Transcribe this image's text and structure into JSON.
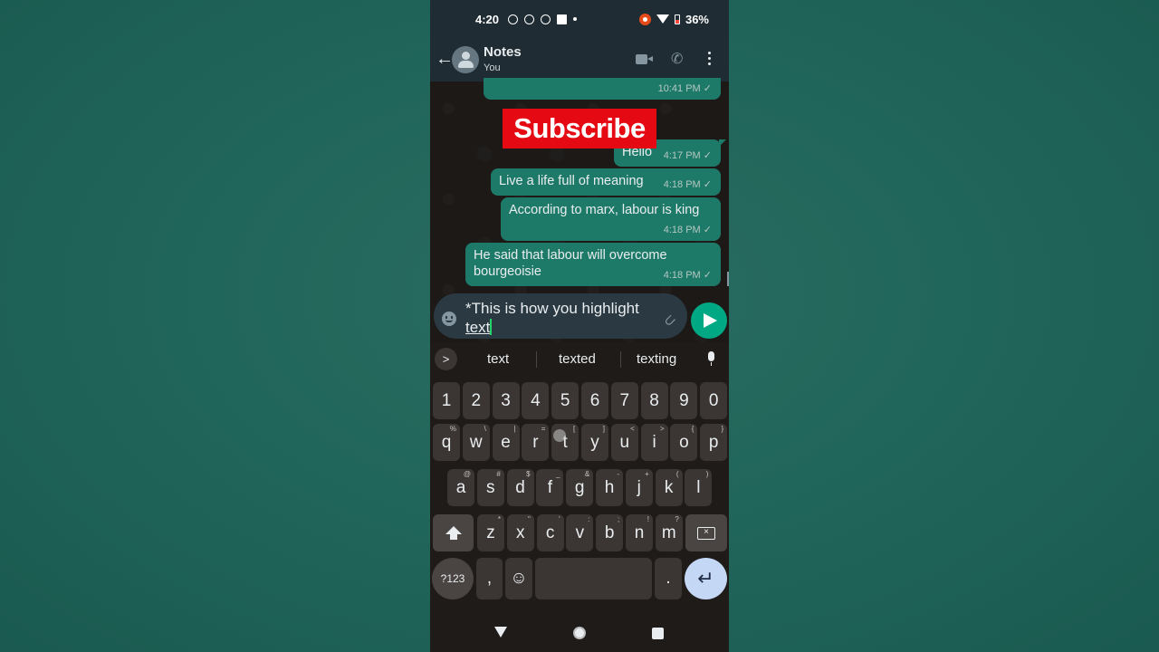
{
  "status_bar": {
    "time": "4:20",
    "battery": "36%"
  },
  "header": {
    "title": "Notes",
    "subtitle": "You"
  },
  "overlay": {
    "subscribe": "Subscribe"
  },
  "messages": [
    {
      "text": "",
      "time": "10:41 PM ✓"
    },
    {
      "text": "Hello",
      "time": "4:17 PM ✓"
    },
    {
      "text": "Live a life full of meaning",
      "time": "4:18 PM ✓"
    },
    {
      "text": "According to marx, labour is king",
      "time": "4:18 PM ✓"
    },
    {
      "text": "He said that labour will overcome bourgeoisie",
      "time": "4:18 PM ✓"
    }
  ],
  "composer": {
    "line1": "*This is how you highlight",
    "line2": "text"
  },
  "suggestions": [
    "text",
    "texted",
    "texting"
  ],
  "keyboard": {
    "numbers": [
      "1",
      "2",
      "3",
      "4",
      "5",
      "6",
      "7",
      "8",
      "9",
      "0"
    ],
    "row1": [
      "q",
      "w",
      "e",
      "r",
      "t",
      "y",
      "u",
      "i",
      "o",
      "p"
    ],
    "row1_alt": [
      "%",
      "\\",
      "|",
      "=",
      "[",
      "]",
      "<",
      ">",
      "{",
      "}"
    ],
    "row2": [
      "a",
      "s",
      "d",
      "f",
      "g",
      "h",
      "j",
      "k",
      "l"
    ],
    "row2_alt": [
      "@",
      "#",
      "$",
      "_",
      "&",
      "-",
      "+",
      "(",
      ")"
    ],
    "row3": [
      "z",
      "x",
      "c",
      "v",
      "b",
      "n",
      "m"
    ],
    "row3_alt": [
      "*",
      "\"",
      "'",
      ":",
      ";",
      "!",
      "?"
    ],
    "symbols_label": "?123",
    "comma": ",",
    "period": ".",
    "enter": "↵"
  },
  "colors": {
    "accent": "#00a884",
    "bubble": "#1e7a68",
    "subscribe": "#e50914"
  }
}
